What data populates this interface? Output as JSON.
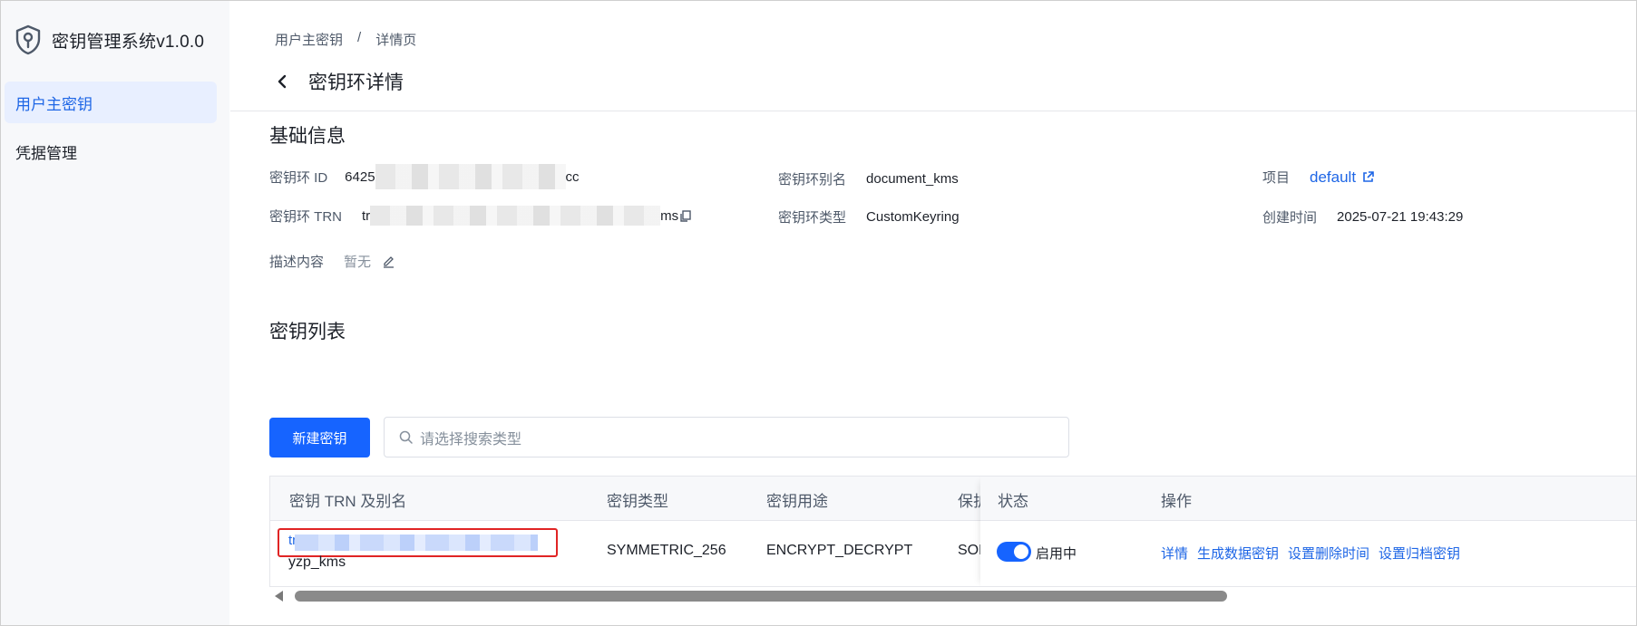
{
  "sidebar": {
    "app_title": "密钥管理系统v1.0.0",
    "items": [
      {
        "label": "用户主密钥",
        "active": true
      },
      {
        "label": "凭据管理",
        "active": false
      }
    ]
  },
  "header": {
    "breadcrumb": [
      "用户主密钥",
      "/",
      "详情页"
    ],
    "title": "密钥环详情"
  },
  "basic": {
    "section_title": "基础信息",
    "id_label": "密钥环 ID",
    "id_prefix": "6425",
    "id_suffix": "cc",
    "alias_label": "密钥环别名",
    "alias_value": "document_kms",
    "project_label": "项目",
    "project_value": "default",
    "trn_label": "密钥环 TRN",
    "trn_prefix": "tr",
    "trn_suffix": "ms",
    "type_label": "密钥环类型",
    "type_value": "CustomKeyring",
    "created_label": "创建时间",
    "created_value": "2025-07-21 19:43:29",
    "desc_label": "描述内容",
    "desc_value": "暂无"
  },
  "keys": {
    "section_title": "密钥列表",
    "new_button": "新建密钥",
    "search_placeholder": "请选择搜索类型",
    "columns": [
      "密钥 TRN 及别名",
      "密钥类型",
      "密钥用途",
      "保护",
      "状态",
      "操作"
    ],
    "rows": [
      {
        "trn_prefix": "tr",
        "alias": "yzp_kms",
        "key_type": "SYMMETRIC_256",
        "usage": "ENCRYPT_DECRYPT",
        "protection": "SOF",
        "status": "启用中",
        "enabled": true,
        "actions": [
          "详情",
          "生成数据密钥",
          "设置删除时间",
          "设置归档密钥"
        ]
      }
    ]
  },
  "colors": {
    "accent": "#1664ff",
    "link": "#1e66e6",
    "highlight": "#e02424"
  }
}
